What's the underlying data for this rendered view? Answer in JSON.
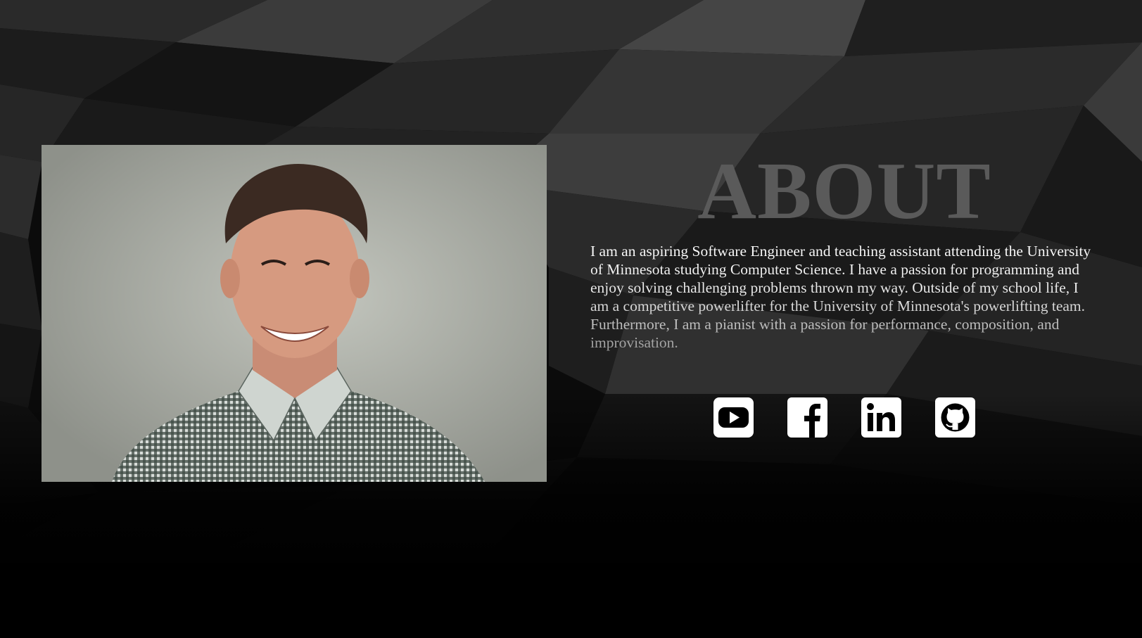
{
  "about": {
    "title": "ABOUT",
    "body": "I am an aspiring Software Engineer and teaching assistant attending the University of Minnesota studying Computer Science. I have a passion for programming and enjoy solving challenging problems thrown my way. Outside of my school life, I am a competitive powerlifter for the University of Minnesota's powerlifting team. Furthermore, I am a pianist with a passion for performance, composition, and improvisation."
  },
  "photo": {
    "icon": "portrait-photo"
  },
  "socials": [
    {
      "icon": "youtube-icon"
    },
    {
      "icon": "facebook-icon"
    },
    {
      "icon": "linkedin-icon"
    },
    {
      "icon": "github-icon"
    }
  ],
  "colors": {
    "background": "#000000",
    "title": "#5a5a5a",
    "text": "#ffffff",
    "icon": "#ffffff"
  }
}
